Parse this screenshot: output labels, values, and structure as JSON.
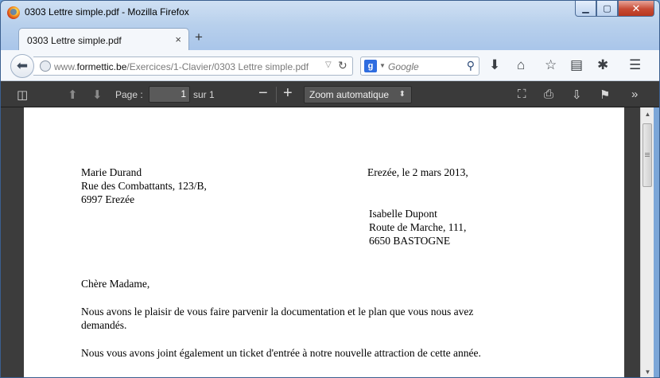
{
  "window": {
    "title": "0303 Lettre simple.pdf - Mozilla Firefox"
  },
  "tab": {
    "label": "0303 Lettre simple.pdf",
    "close": "×",
    "new_tab": "+"
  },
  "nav": {
    "url_prefix": "www.",
    "url_domain": "formettic.be",
    "url_path": "/Exercices/1-Clavier/0303 Lettre simple.pdf",
    "search_placeholder": "Google",
    "search_engine_icon": "g"
  },
  "pdf_toolbar": {
    "page_label": "Page :",
    "page_value": "1",
    "page_total": "sur 1",
    "zoom_label": "Zoom automatique"
  },
  "letter": {
    "sender": [
      "Marie Durand",
      "Rue des Combattants, 123/B,",
      "6997 Erezée"
    ],
    "date_line": "Erezée, le 2 mars 2013,",
    "recipient": [
      "Isabelle Dupont",
      "Route de Marche, 111,",
      "6650 BASTOGNE"
    ],
    "greeting": "Chère Madame,",
    "para1": [
      "Nous avons le plaisir de vous faire parvenir la documentation et le plan que vous nous avez",
      "demandés."
    ],
    "para2": "Nous vous avons joint également un ticket d'entrée à notre nouvelle attraction de cette année."
  },
  "icons": {
    "firefox": "firefox-logo",
    "minimize": "minimize-icon",
    "maximize": "maximize-icon",
    "close": "close-icon"
  }
}
